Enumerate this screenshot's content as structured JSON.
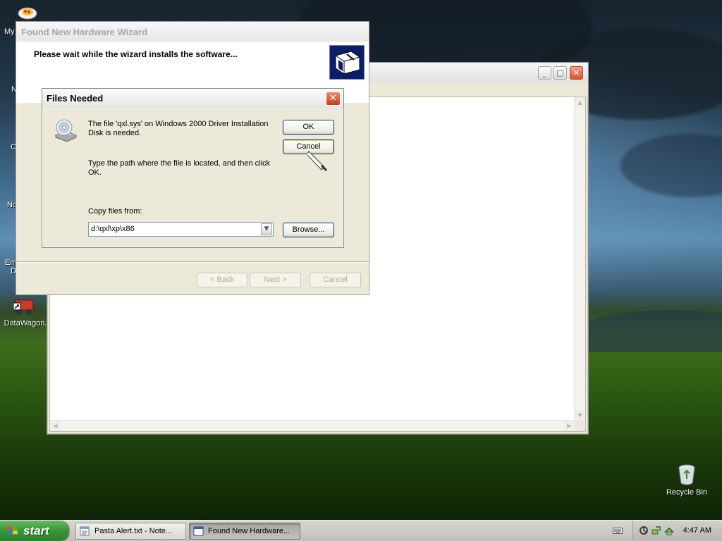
{
  "desktop": {
    "icons": [
      {
        "label": "DataWagon.",
        "name": "datawagon"
      },
      {
        "label": "Recycle Bin",
        "name": "recycle-bin"
      }
    ],
    "partial_labels": [
      "My",
      "N",
      "C",
      "No",
      "Em",
      "D"
    ]
  },
  "wizard": {
    "title": "Found New Hardware Wizard",
    "heading": "Please wait while the wizard installs the software...",
    "back_label": "< Back",
    "next_label": "Next >",
    "cancel_label": "Cancel"
  },
  "files_needed": {
    "title": "Files Needed",
    "close_label": "✕",
    "message": "The file 'qxl.sys' on Windows 2000 Driver Installation Disk is needed.",
    "instruction": "Type the path where the file is located, and then click OK.",
    "copy_from_label": "Copy files from:",
    "copy_from_value": "d:\\qxl\\xp\\x86",
    "ok_label": "OK",
    "cancel_label": "Cancel",
    "browse_label": "Browse..."
  },
  "taskbar": {
    "start_label": "start",
    "tasks": [
      {
        "label": "Pasta Alert.txt - Note...",
        "active": false
      },
      {
        "label": "Found New Hardware...",
        "active": true
      }
    ],
    "clock": "4:47 AM"
  }
}
